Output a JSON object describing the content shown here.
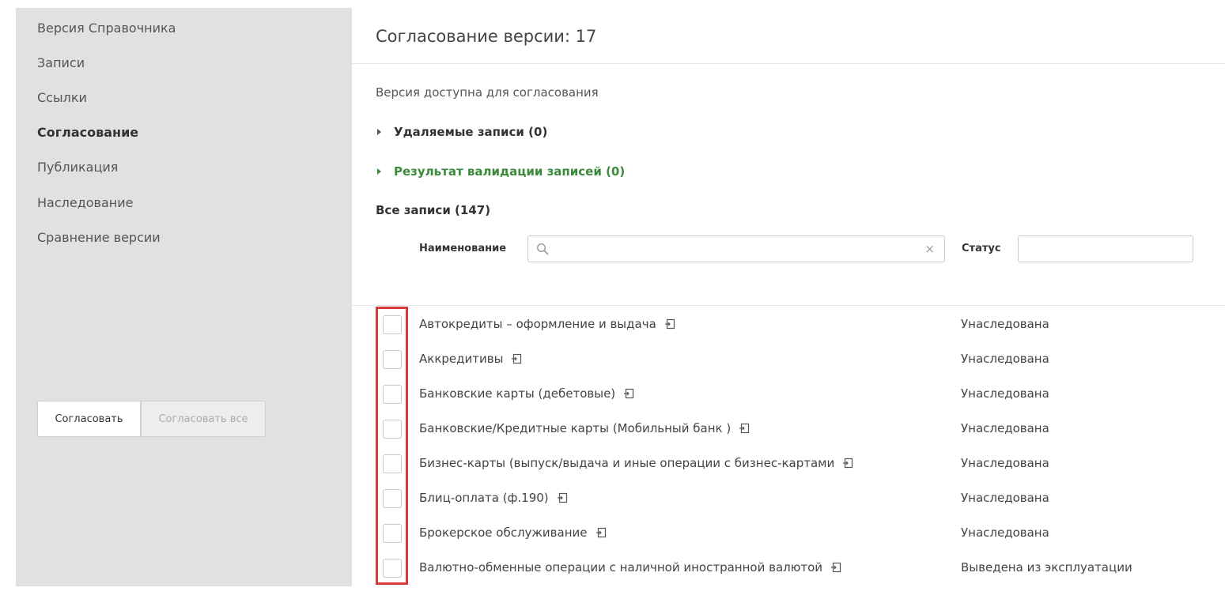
{
  "sidebar": {
    "items": [
      {
        "label": "Версия Справочника",
        "active": false
      },
      {
        "label": "Записи",
        "active": false
      },
      {
        "label": "Ссылки",
        "active": false
      },
      {
        "label": "Согласование",
        "active": true
      },
      {
        "label": "Публикация",
        "active": false
      },
      {
        "label": "Наследование",
        "active": false
      },
      {
        "label": "Сравнение версии",
        "active": false
      }
    ],
    "approve_label": "Согласовать",
    "approve_all_label": "Согласовать все"
  },
  "main": {
    "title": "Согласование версии: 17",
    "availability_note": "Версия доступна для согласования",
    "deleted_section": "Удаляемые записи (0)",
    "validation_section": "Результат валидации записей (0)",
    "all_records": "Все записи (147)",
    "filter": {
      "name_label": "Наименование",
      "name_value": "",
      "status_label": "Статус",
      "status_value": "",
      "clear_glyph": "×"
    },
    "rows": [
      {
        "name": "Автокредиты – оформление и выдача",
        "status": "Унаследована",
        "checked": false
      },
      {
        "name": "Аккредитивы",
        "status": "Унаследована",
        "checked": false
      },
      {
        "name": "Банковские карты (дебетовые)",
        "status": "Унаследована",
        "checked": false
      },
      {
        "name": "Банковские/Кредитные карты (Мобильный банк )",
        "status": "Унаследована",
        "checked": false
      },
      {
        "name": "Бизнес-карты (выпуск/выдача и иные операции с бизнес-картами",
        "status": "Унаследована",
        "checked": false
      },
      {
        "name": "Блиц-оплата (ф.190)",
        "status": "Унаследована",
        "checked": false
      },
      {
        "name": "Брокерское обслуживание",
        "status": "Унаследована",
        "checked": false
      },
      {
        "name": "Валютно-обменные операции с наличной иностранной валютой",
        "status": "Выведена из эксплуатации",
        "checked": false
      }
    ]
  },
  "colors": {
    "sidebar_bg": "#e1e1e1",
    "validation_green": "#3b8a3b",
    "highlight_red": "#d93a3a"
  },
  "icons": {
    "search": "search-icon",
    "clear": "close-icon",
    "row_link": "inherit-link-icon",
    "section_toggle": "caret-right-icon"
  }
}
